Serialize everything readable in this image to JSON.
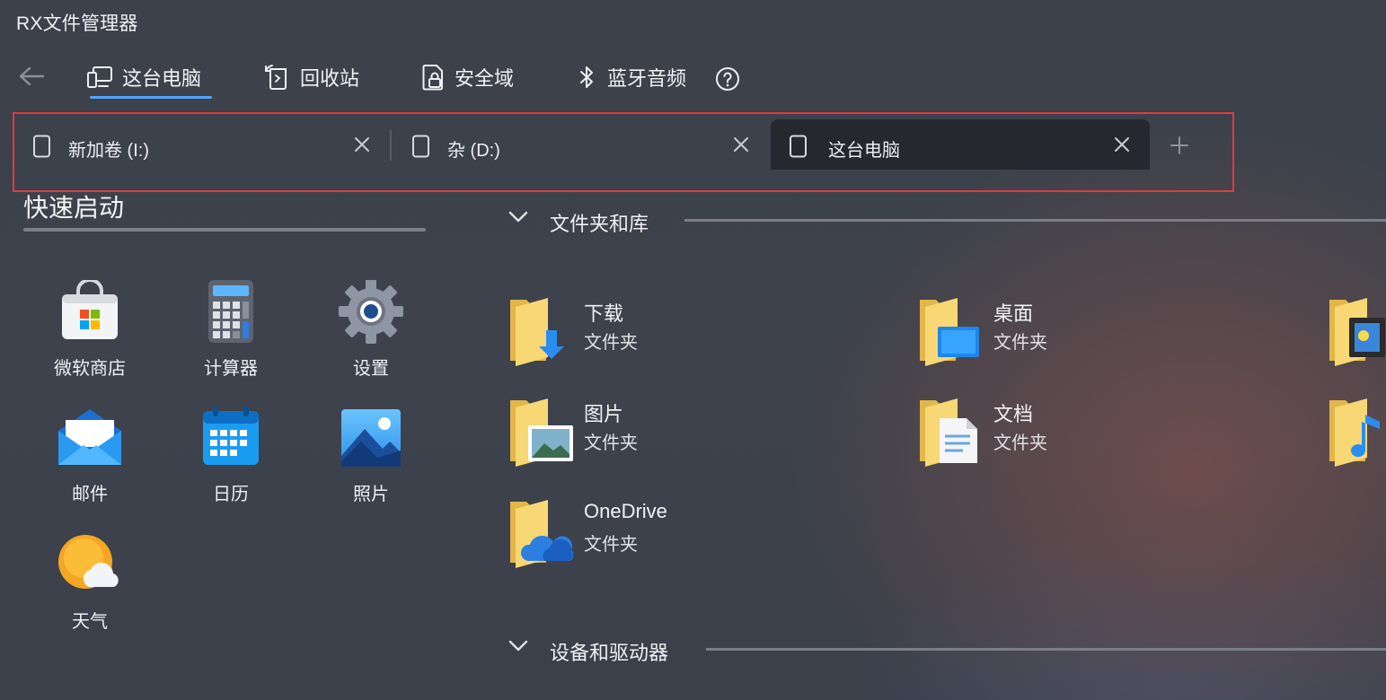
{
  "app": {
    "title": "RX文件管理器"
  },
  "nav": {
    "items": [
      {
        "label": "这台电脑",
        "icon": "this-pc-icon",
        "active": true
      },
      {
        "label": "回收站",
        "icon": "recycle-bin-icon"
      },
      {
        "label": "安全域",
        "icon": "secure-vault-icon"
      },
      {
        "label": "蓝牙音频",
        "icon": "bluetooth-icon"
      }
    ],
    "help_icon": "help-circle-icon",
    "back_icon": "back-arrow-icon",
    "accent": "#4ea6ff"
  },
  "tabs": {
    "items": [
      {
        "label": "新加卷 (I:)",
        "icon": "drive-icon",
        "active": false
      },
      {
        "label": "杂 (D:)",
        "icon": "drive-icon",
        "active": false
      },
      {
        "label": "这台电脑",
        "icon": "drive-icon",
        "active": true
      }
    ],
    "add_icon": "plus-icon",
    "close_icon": "close-icon",
    "highlight_color": "#e03a40"
  },
  "quick_launch": {
    "title": "快速启动",
    "apps": [
      {
        "label": "微软商店",
        "icon": "store-icon"
      },
      {
        "label": "计算器",
        "icon": "calculator-icon"
      },
      {
        "label": "设置",
        "icon": "settings-gear-icon"
      },
      {
        "label": "邮件",
        "icon": "mail-icon"
      },
      {
        "label": "日历",
        "icon": "calendar-icon"
      },
      {
        "label": "照片",
        "icon": "photos-icon"
      },
      {
        "label": "天气",
        "icon": "weather-icon"
      }
    ]
  },
  "libraries": {
    "title": "文件夹和库",
    "folders": [
      {
        "name": "下载",
        "type": "文件夹",
        "icon": "downloads-folder-icon"
      },
      {
        "name": "桌面",
        "type": "文件夹",
        "icon": "desktop-folder-icon"
      },
      {
        "name": "图片",
        "type": "文件夹",
        "icon": "pictures-folder-icon"
      },
      {
        "name": "文档",
        "type": "文件夹",
        "icon": "documents-folder-icon"
      },
      {
        "name": "OneDrive",
        "type": "文件夹",
        "icon": "onedrive-folder-icon"
      }
    ]
  },
  "devices": {
    "title": "设备和驱动器"
  }
}
